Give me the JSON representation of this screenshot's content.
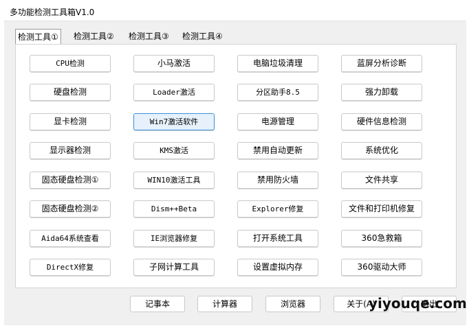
{
  "window": {
    "title": "多功能检测工具箱V1.0"
  },
  "tabs": [
    "检测工具①",
    "检测工具②",
    "检测工具③",
    "检测工具④"
  ],
  "grid": [
    [
      "CPU检测",
      "小马激活",
      "电脑垃圾清理",
      "蓝屏分析诊断"
    ],
    [
      "硬盘检测",
      "Loader激活",
      "分区助手8.5",
      "强力卸载"
    ],
    [
      "显卡检测",
      "Win7激活软件",
      "电源管理",
      "硬件信息检测"
    ],
    [
      "显示器检测",
      "KMS激活",
      "禁用自动更新",
      "系统优化"
    ],
    [
      "固态硬盘检测①",
      "WIN10激活工具",
      "禁用防火墙",
      "文件共享"
    ],
    [
      "固态硬盘检测②",
      "Dism++Beta",
      "Explorer修复",
      "文件和打印机修复"
    ],
    [
      "Aida64系统查看",
      "IE浏览器修复",
      "打开系统工具",
      "360急救箱"
    ],
    [
      "DirectX修复",
      "子网计算工具",
      "设置虚拟内存",
      "360驱动大师"
    ]
  ],
  "bottom_buttons": [
    "记事本",
    "计算器",
    "浏览器",
    "关于(A)",
    "退出"
  ],
  "watermark": "yiyouqe.com"
}
